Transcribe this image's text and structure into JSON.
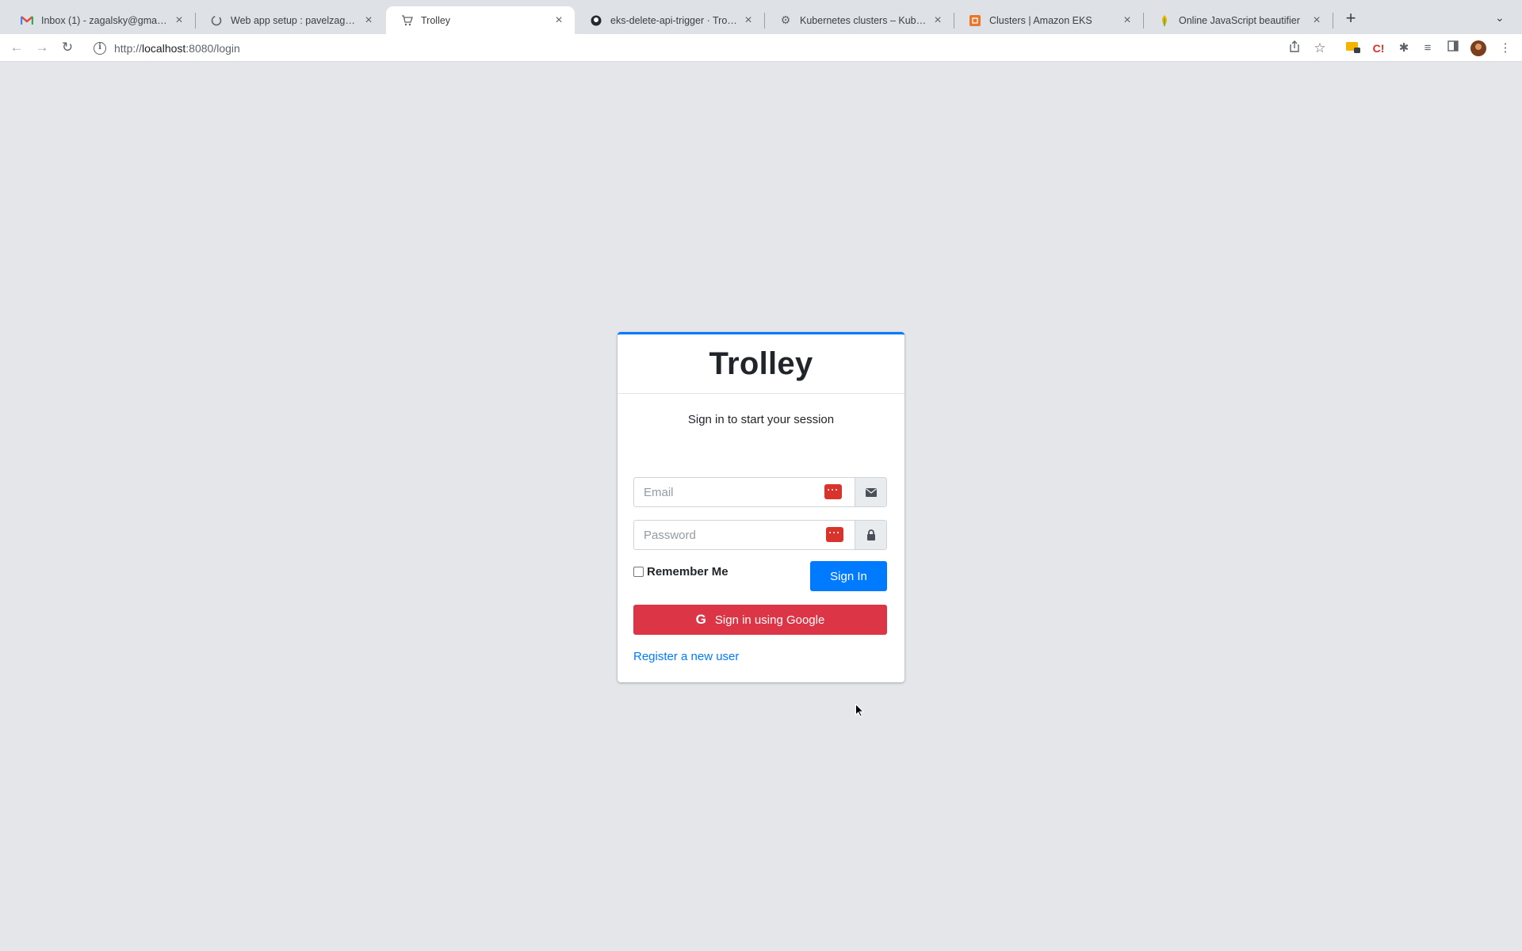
{
  "browser": {
    "tabs": [
      {
        "title": "Inbox (1) - zagalsky@gmail.com",
        "icon": "gmail-icon"
      },
      {
        "title": "Web app setup : pavelzagalsky",
        "icon": "loop-icon"
      },
      {
        "title": "Trolley",
        "icon": "cart-icon",
        "active": true
      },
      {
        "title": "eks-delete-api-trigger · Trolley",
        "icon": "github-icon"
      },
      {
        "title": "Kubernetes clusters – Kubernetes",
        "icon": "gear-icon"
      },
      {
        "title": "Clusters | Amazon EKS",
        "icon": "aws-icon"
      },
      {
        "title": "Online JavaScript beautifier",
        "icon": "beautifier-icon"
      }
    ],
    "url_scheme": "http://",
    "url_host": "localhost",
    "url_rest": ":8080/login"
  },
  "login": {
    "brand": "Trolley",
    "message": "Sign in to start your session",
    "email_placeholder": "Email",
    "password_placeholder": "Password",
    "remember_label": "Remember Me",
    "signin_label": "Sign In",
    "google_label": "Sign in using Google",
    "register_label": "Register a new user"
  },
  "colors": {
    "accent": "#007bff",
    "google_button": "#dc3545",
    "page_background": "#e4e6e9"
  }
}
